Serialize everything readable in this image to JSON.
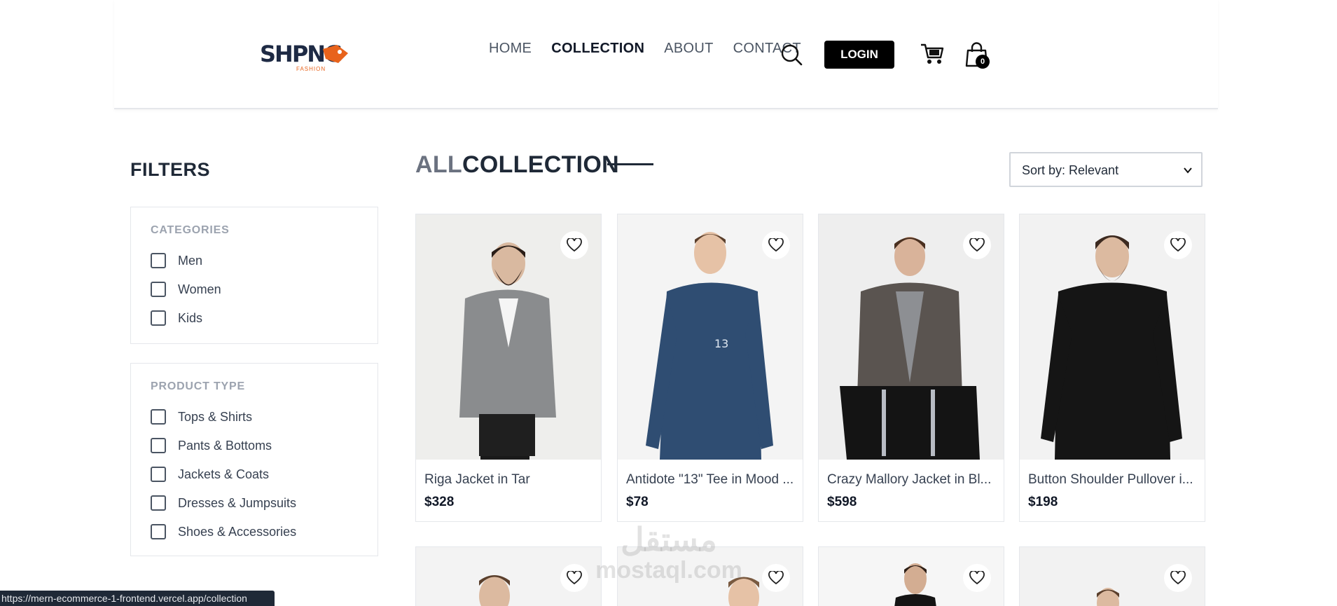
{
  "header": {
    "logo": {
      "word": "SHPNG",
      "sub": "FASHION"
    },
    "nav": [
      "HOME",
      "COLLECTION",
      "ABOUT",
      "CONTACT"
    ],
    "active_nav": "COLLECTION",
    "login_label": "LOGIN",
    "bag_count": "0",
    "icons": [
      "search-icon",
      "cart-icon",
      "bag-icon"
    ]
  },
  "filters": {
    "title": "FILTERS",
    "categories": {
      "heading": "CATEGORIES",
      "options": [
        "Men",
        "Women",
        "Kids"
      ]
    },
    "product_type": {
      "heading": "PRODUCT TYPE",
      "options": [
        "Tops & Shirts",
        "Pants & Bottoms",
        "Jackets & Coats",
        "Dresses & Jumpsuits",
        "Shoes & Accessories"
      ]
    }
  },
  "collection": {
    "title_a": "ALL",
    "title_b": "COLLECTION",
    "sort_label": "Sort by: Relevant",
    "products": [
      {
        "name": "Riga Jacket in Tar",
        "price": "$328"
      },
      {
        "name": "Antidote \"13\" Tee in Mood ...",
        "price": "$78"
      },
      {
        "name": "Crazy Mallory Jacket in Bl...",
        "price": "$598"
      },
      {
        "name": "Button Shoulder Pullover i...",
        "price": "$198"
      }
    ]
  },
  "watermark": {
    "arabic": "مستقل",
    "latin": "mostaql.com"
  },
  "status_url": "https://mern-ecommerce-1-frontend.vercel.app/collection",
  "colors": {
    "accent_orange": "#e8631c",
    "logo_navy": "#1e2a44",
    "button_black": "#000000"
  }
}
